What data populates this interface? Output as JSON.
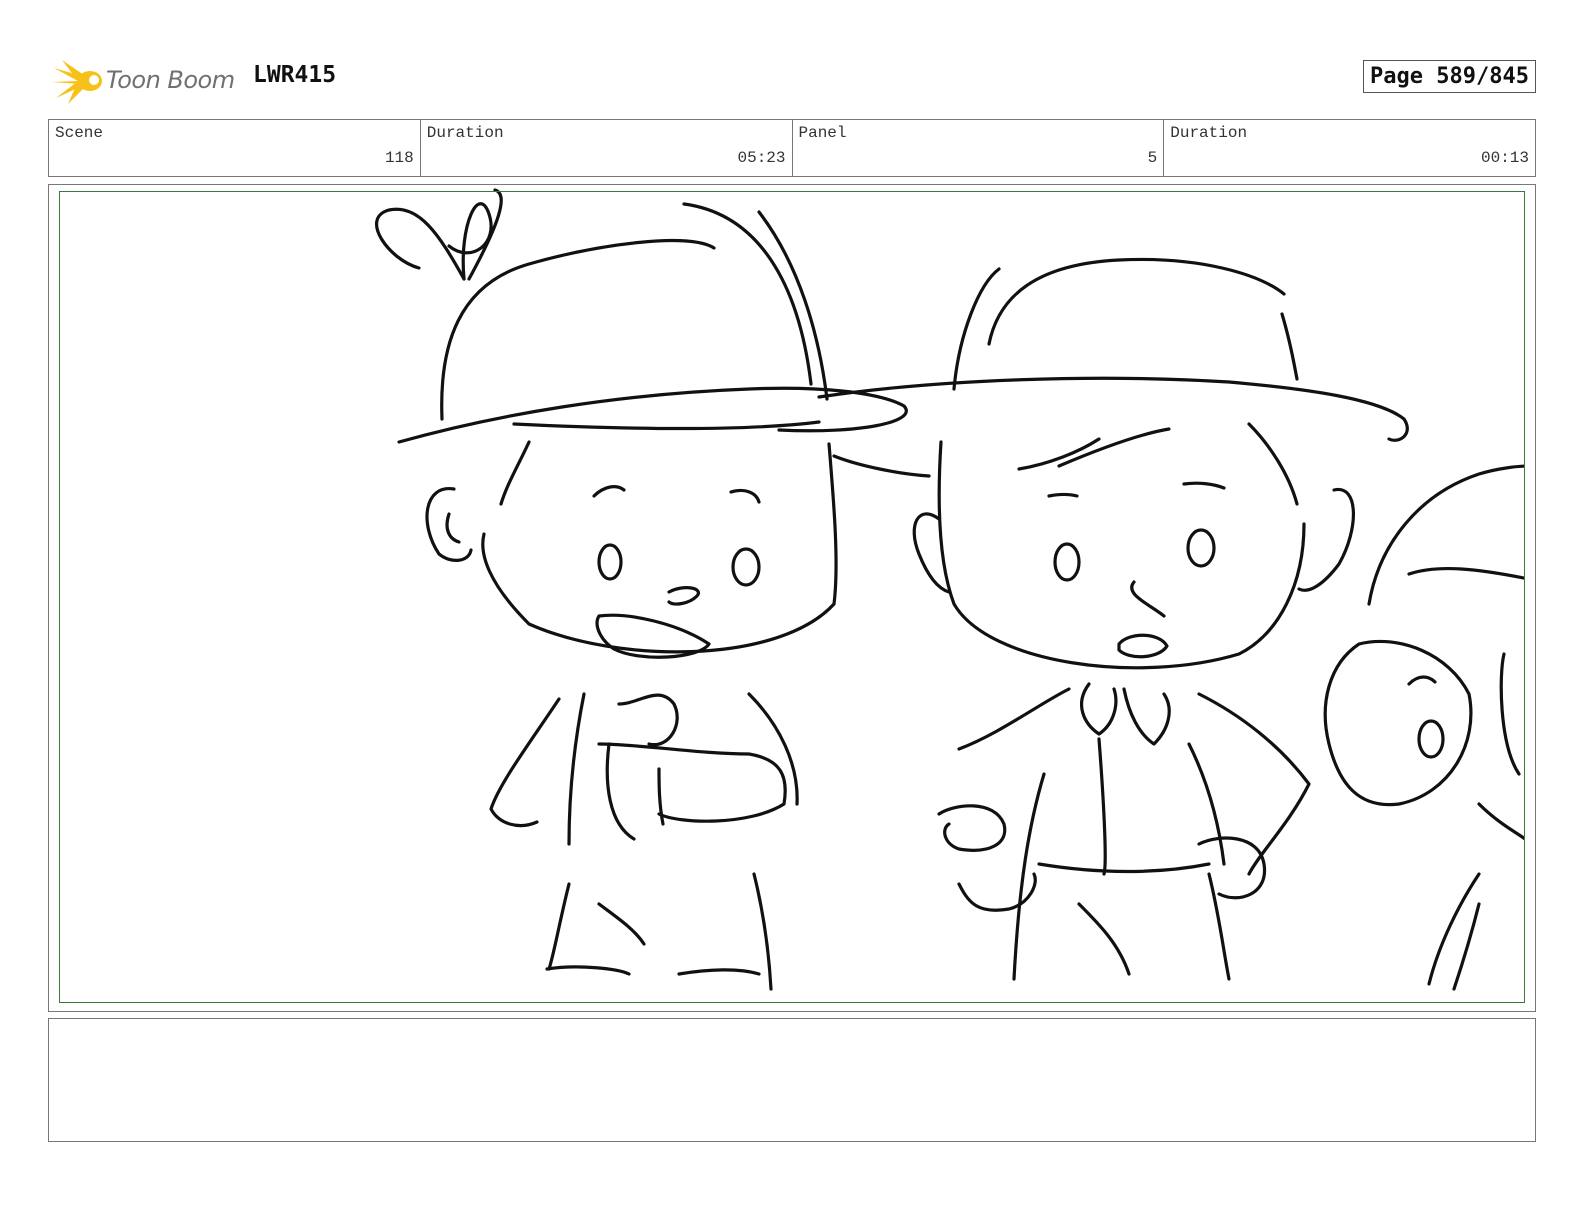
{
  "header": {
    "logo_text": "Toon Boom",
    "project_code": "LWR415",
    "page_label": "Page 589/845"
  },
  "info": {
    "scene_label": "Scene",
    "scene_value": "118",
    "duration_label": "Duration",
    "duration_value": "05:23",
    "panel_label": "Panel",
    "panel_value": "5",
    "panel_duration_label": "Duration",
    "panel_duration_value": "00:13"
  },
  "colors": {
    "logo_accent": "#f6c21a",
    "frame_border": "#3a7a3a"
  },
  "icons": {
    "logo": "toon-boom-starburst-icon"
  }
}
